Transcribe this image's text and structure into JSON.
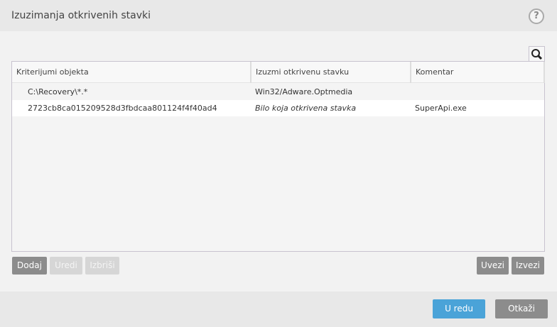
{
  "title": "Izuzimanja otkrivenih stavki",
  "help": "?",
  "columns": [
    "Kriterijumi objekta",
    "Izuzmi otkrivenu stavku",
    "Komentar"
  ],
  "rows": [
    {
      "object": "C:\\Recovery\\*.*",
      "detection": "Win32/Adware.Optmedia",
      "comment": ""
    },
    {
      "object": "2723cb8ca015209528d3fbdcaa801124f4f40ad4",
      "detection": "Bilo koja otkrivena stavka",
      "comment": "SuperApi.exe"
    }
  ],
  "buttons": {
    "add": "Dodaj",
    "edit": "Uredi",
    "delete": "Izbriši",
    "import": "Uvezi",
    "export": "Izvezi"
  },
  "footer": {
    "ok": "U redu",
    "cancel": "Otkaži"
  },
  "colors": {
    "accent": "#4aa3d8",
    "button": "#8c8c8c"
  }
}
